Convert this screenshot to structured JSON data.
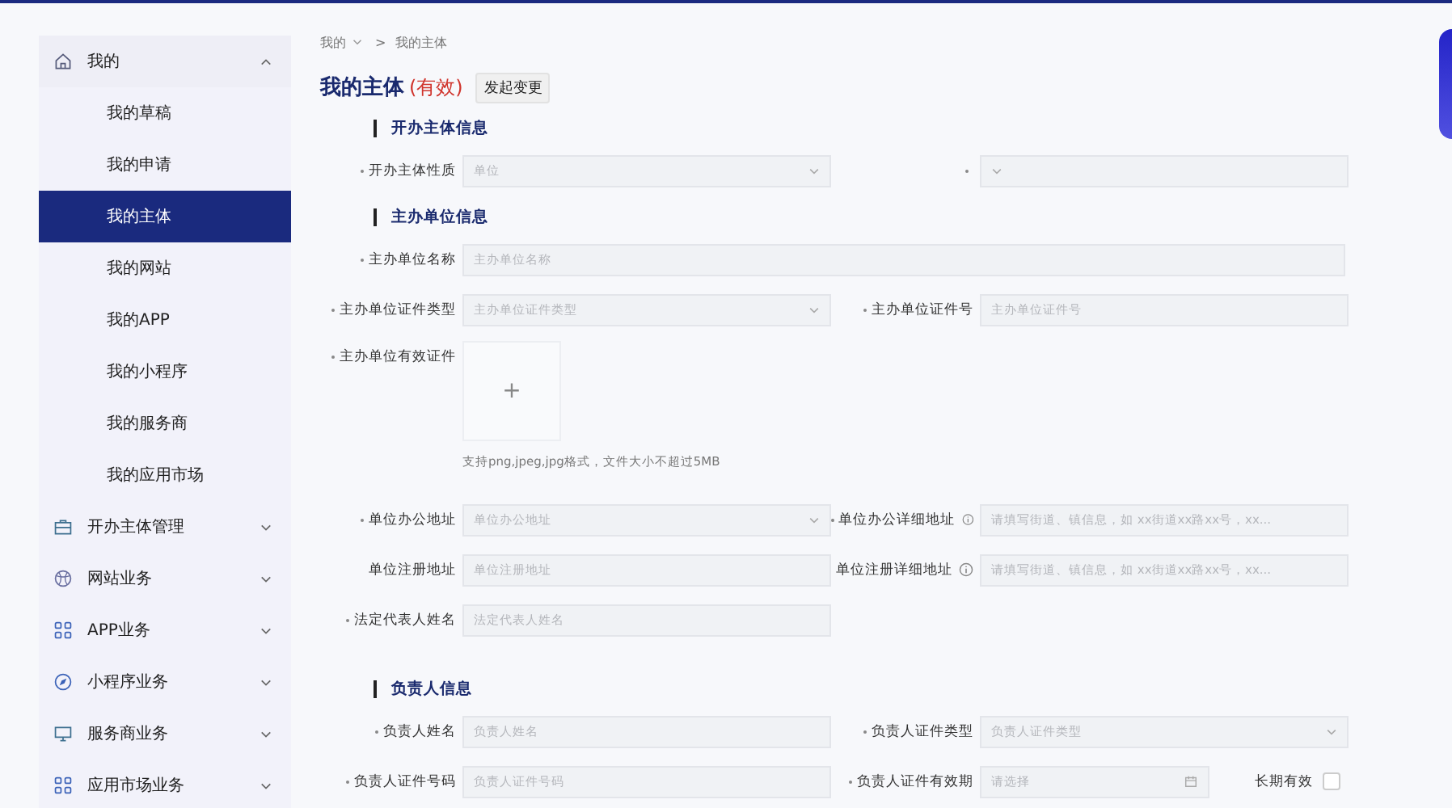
{
  "sidebar": {
    "groups": [
      {
        "label": "我的",
        "expanded": true,
        "children": [
          {
            "label": "我的草稿",
            "selected": false
          },
          {
            "label": "我的申请",
            "selected": false
          },
          {
            "label": "我的主体",
            "selected": true
          },
          {
            "label": "我的网站",
            "selected": false
          },
          {
            "label": "我的APP",
            "selected": false
          },
          {
            "label": "我的小程序",
            "selected": false
          },
          {
            "label": "我的服务商",
            "selected": false
          },
          {
            "label": "我的应用市场",
            "selected": false
          }
        ]
      },
      {
        "label": "开办主体管理",
        "expanded": false
      },
      {
        "label": "网站业务",
        "expanded": false
      },
      {
        "label": "APP业务",
        "expanded": false
      },
      {
        "label": "小程序业务",
        "expanded": false
      },
      {
        "label": "服务商业务",
        "expanded": false
      },
      {
        "label": "应用市场业务",
        "expanded": false
      }
    ]
  },
  "breadcrumb": {
    "items": [
      "我的",
      "我的主体"
    ],
    "separator": ">"
  },
  "header": {
    "title": "我的主体",
    "status": "(有效)",
    "button": "发起变更"
  },
  "sections": [
    {
      "title": "开办主体信息",
      "rows": [
        [
          {
            "label": "开办主体性质",
            "required": true,
            "kind": "select",
            "value": "单位"
          },
          {
            "required": true,
            "kind": "select"
          }
        ]
      ]
    },
    {
      "title": "主办单位信息",
      "rows": [
        [
          {
            "label": "主办单位名称",
            "required": true,
            "kind": "input",
            "wide": true,
            "placeholder": "主办单位名称"
          }
        ],
        [
          {
            "label": "主办单位证件类型",
            "required": true,
            "kind": "select",
            "placeholder": "主办单位证件类型"
          },
          {
            "label": "主办单位证件号",
            "required": true,
            "kind": "input",
            "placeholder": "主办单位证件号"
          }
        ],
        [
          {
            "label": "主办单位有效证件",
            "required": true,
            "kind": "upload",
            "symbol": "+",
            "hint": "支持png,jpeg,jpg格式，文件大小不超过5MB"
          }
        ],
        [
          {
            "label": "单位办公地址",
            "required": true,
            "kind": "select",
            "placeholder": "单位办公地址"
          },
          {
            "label": "单位办公详细地址",
            "required": true,
            "info": true,
            "kind": "input",
            "placeholder": "请填写街道、镇信息，如 xx街道xx路xx号，xx..."
          }
        ],
        [
          {
            "label": "单位注册地址",
            "required": false,
            "kind": "input",
            "placeholder": "单位注册地址"
          },
          {
            "label": "单位注册详细地址",
            "required": false,
            "info": true,
            "kind": "input",
            "placeholder": "请填写街道、镇信息，如 xx街道xx路xx号，xx..."
          }
        ],
        [
          {
            "label": "法定代表人姓名",
            "required": true,
            "kind": "input",
            "placeholder": "法定代表人姓名"
          }
        ]
      ]
    },
    {
      "title": "负责人信息",
      "rows": [
        [
          {
            "label": "负责人姓名",
            "required": true,
            "kind": "input",
            "placeholder": "负责人姓名"
          },
          {
            "label": "负责人证件类型",
            "required": true,
            "kind": "select",
            "placeholder": "负责人证件类型"
          }
        ],
        [
          {
            "label": "负责人证件号码",
            "required": true,
            "kind": "input",
            "placeholder": "负责人证件号码"
          },
          {
            "label": "负责人证件有效期",
            "required": true,
            "kind": "date",
            "placeholder": "请选择"
          },
          {
            "label": "长期有效",
            "kind": "checkbox",
            "checked": false
          }
        ]
      ]
    }
  ]
}
